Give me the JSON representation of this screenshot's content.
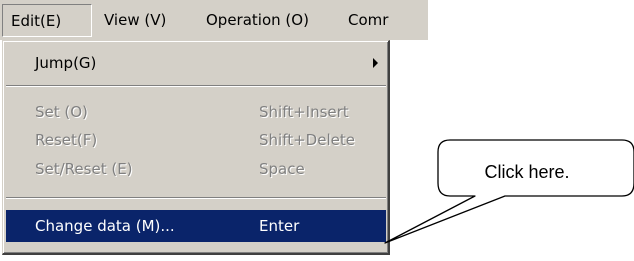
{
  "menubar": {
    "items": [
      {
        "label": "Edit(E)"
      },
      {
        "label": "View (V)"
      },
      {
        "label": "Operation (O)"
      },
      {
        "label": "Comr"
      }
    ]
  },
  "dropdown": {
    "items": [
      {
        "label": "Jump(G)",
        "shortcut": "",
        "submenu": true,
        "enabled": true
      },
      {
        "label": "Set (O)",
        "shortcut": "Shift+Insert",
        "enabled": false
      },
      {
        "label": "Reset(F)",
        "shortcut": "Shift+Delete",
        "enabled": false
      },
      {
        "label": "Set/Reset (E)",
        "shortcut": "Space",
        "enabled": false
      },
      {
        "label": "Change data (M)...",
        "shortcut": "Enter",
        "enabled": true,
        "selected": true
      }
    ]
  },
  "callout": {
    "text": "Click here."
  },
  "colors": {
    "menu_face": "#d4d0c8",
    "highlight": "#0a246a",
    "disabled_text": "#808080"
  },
  "icons": {
    "submenu": "triangle-right"
  }
}
